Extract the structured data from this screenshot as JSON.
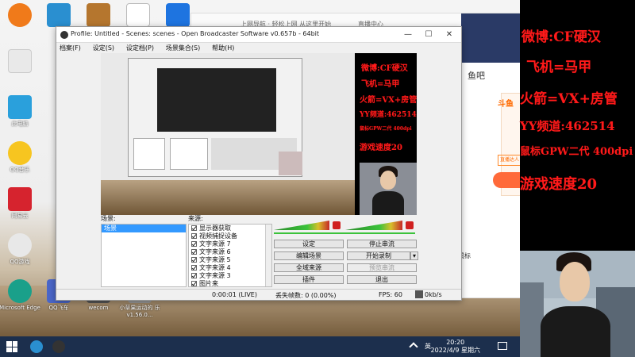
{
  "desktop": {
    "icons": [
      {
        "label": "",
        "color": "#f07a1a"
      },
      {
        "label": "",
        "color": "#2a8fd0"
      },
      {
        "label": "",
        "color": "#b5762e"
      },
      {
        "label": "",
        "color": "#ffffff"
      },
      {
        "label": "",
        "color": "#1e74e0"
      },
      {
        "label": "",
        "color": "#e9e9e9"
      },
      {
        "label": "此电脑",
        "color": "#2aa0dc"
      },
      {
        "label": "QQ音乐",
        "color": "#f7c520"
      },
      {
        "label": "网易云",
        "color": "#d6232e"
      },
      {
        "label": "QQ游戏",
        "color": "#e8e8e8"
      },
      {
        "label": "Microsoft Edge",
        "color": "#1aa08a"
      },
      {
        "label": "QQ飞车",
        "color": "#4a66c8"
      },
      {
        "label": "wecom",
        "color": "#555"
      },
      {
        "label": "小草果运动的 乐v1.56.0...",
        "color": "#999"
      }
    ]
  },
  "browser": {
    "tab_text": "上网导航 · 轻松上网 从这里开始",
    "tab_text2": "直播中心",
    "right_text": "鱼吧",
    "side_label": "斗鱼",
    "side_text": "直播达人榜",
    "ban_text": "鼠标"
  },
  "obs": {
    "title": "Profile: Untitled - Scenes: scenes - Open Broadcaster Software v0.657b - 64bit",
    "menu": [
      "档案(F)",
      "设定(S)",
      "设定档(P)",
      "场景集合(S)",
      "帮助(H)"
    ],
    "scenes_label": "场景:",
    "sources_label": "来源:",
    "scenes": [
      "场景"
    ],
    "sources": [
      "显示器获取",
      "视频捕捉设备",
      "文字来源 7",
      "文字来源 6",
      "文字来源 5",
      "文字来源 4",
      "文字来源 3",
      "图片来"
    ],
    "buttons": {
      "settings": "设定",
      "stop_stream": "停止串流",
      "edit_scene": "编辑场景",
      "start_record": "开始录制",
      "global_sources": "全域来源",
      "preview_stream": "预览串流",
      "plugins": "插件",
      "exit": "退出"
    },
    "status": {
      "time": "0:00:01 (LIVE)",
      "dropped": "丢失帧数: 0 (0.00%)",
      "fps": "FPS: 60",
      "kbps": "0kb/s"
    }
  },
  "overlay": {
    "lines": [
      "微博:CF硬汉",
      "飞机=马甲",
      "火箭=VX+房管",
      "YY频道:462514",
      "鼠标GPW二代 400dpi",
      "游戏速度20"
    ],
    "color": "#ff1a1a"
  },
  "taskbar": {
    "ime": "英",
    "time": "20:20",
    "date": "2022/4/9 星期六",
    "tb_color": "#1c2f4d"
  }
}
